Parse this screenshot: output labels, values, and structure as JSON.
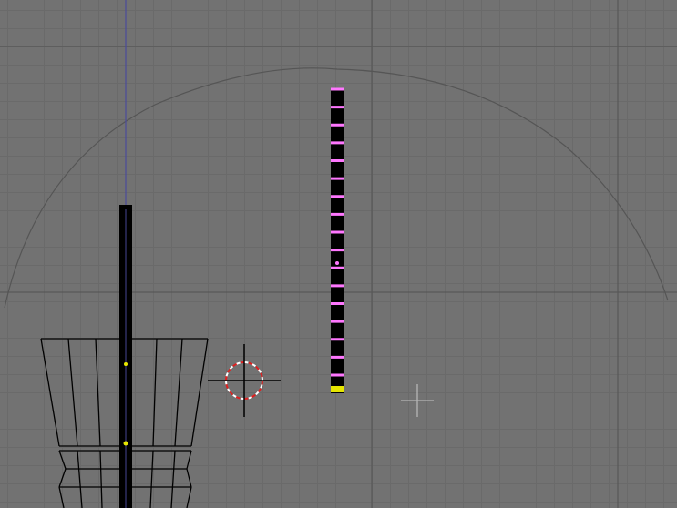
{
  "viewport": {
    "kind": "3d-viewport-front-orthographic",
    "grid": true,
    "colors": {
      "background": "#727272",
      "grid_minor": "#6a6a6a",
      "grid_major": "#595959",
      "wire": "#000000",
      "selected_vertex": "#ff77ff",
      "active_vertex": "#e6e600",
      "axis_z": "#4040a0",
      "circle": "#585858"
    }
  },
  "objects": [
    {
      "name": "vase-wireframe",
      "icon": "mesh-wireframe"
    },
    {
      "name": "vertical-bar-object",
      "icon": "mesh-edit"
    },
    {
      "name": "edit-mode-vertex-column",
      "icon": "vertex-column",
      "selected_vertices": 17,
      "active_vertices": 1
    },
    {
      "name": "large-circle-arc",
      "icon": "circle"
    }
  ],
  "cursor": {
    "icon": "3d-cursor-icon"
  },
  "crosshair": {
    "icon": "crosshair-icon"
  }
}
